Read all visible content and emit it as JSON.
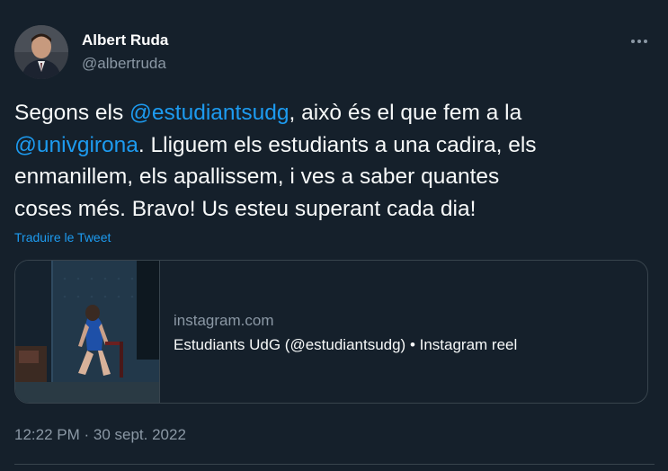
{
  "author": {
    "display_name": "Albert Ruda",
    "handle": "@albertruda"
  },
  "tweet": {
    "lines": [
      {
        "pre": "Segons els ",
        "mention": "@estudiantsudg",
        "post": ", això és el que fem a la"
      },
      {
        "pre": "",
        "mention": "@univgirona",
        "post": ". Lliguem els estudiants a una cadira, els"
      },
      {
        "pre": "enmanillem, els apallissem, i ves a saber quantes",
        "mention": "",
        "post": ""
      },
      {
        "pre": "coses més. Bravo! Us esteu superant cada dia!",
        "mention": "",
        "post": ""
      }
    ],
    "translate_label": "Traduire le Tweet"
  },
  "card": {
    "domain": "instagram.com",
    "title": "Estudiants UdG (@estudiantsudg) • Instagram reel"
  },
  "meta": {
    "time": "12:22 PM",
    "separator": " · ",
    "date": "30 sept. 2022"
  },
  "icons": {
    "more": "more-horizontal-icon"
  },
  "colors": {
    "background": "#15202b",
    "text": "#f7f9f9",
    "secondary": "#8b98a5",
    "accent": "#1d9bf0",
    "border": "#38444d"
  }
}
